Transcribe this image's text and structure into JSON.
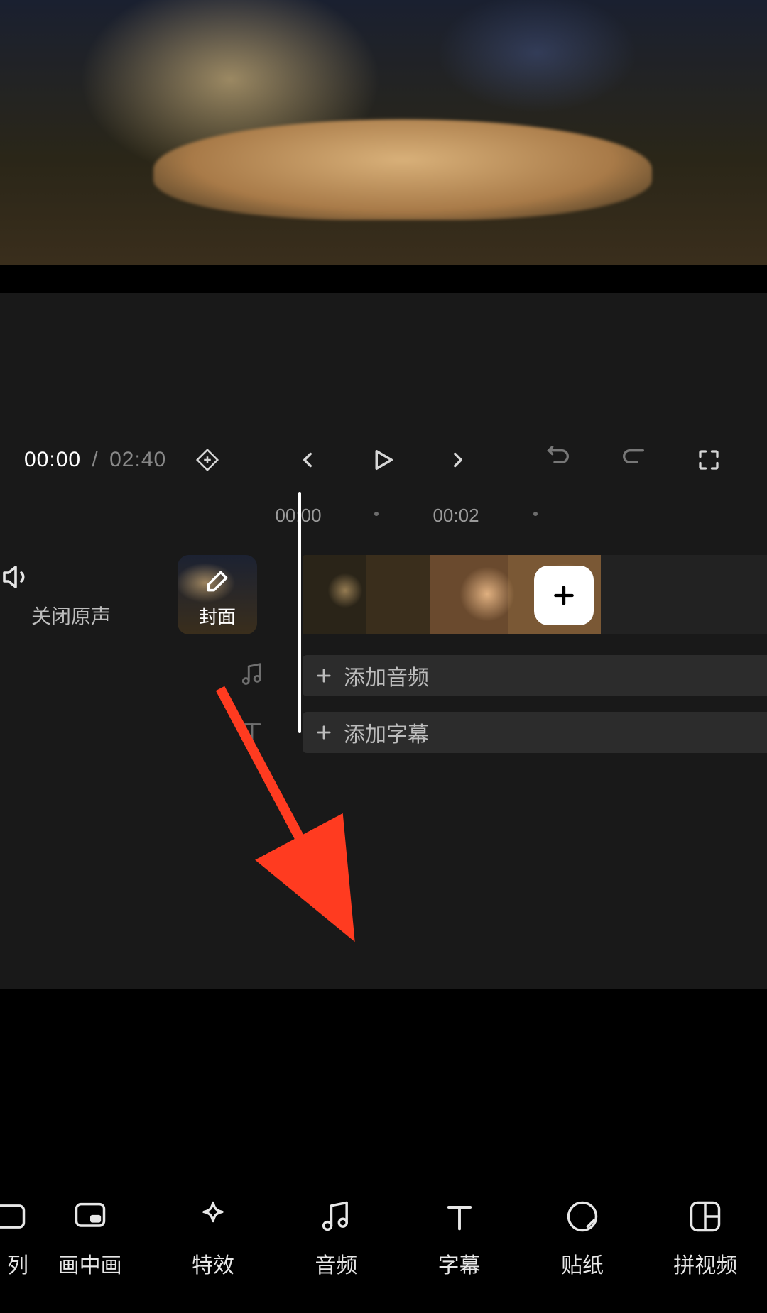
{
  "playback": {
    "current_time": "00:00",
    "separator": "/",
    "duration": "02:40"
  },
  "ruler": {
    "tick1": "00:00",
    "tick2": "00:02"
  },
  "timeline": {
    "mute_label": "关闭原声",
    "cover_label": "封面",
    "add_audio_label": "添加音频",
    "add_subtitle_label": "添加字幕"
  },
  "toolbar": {
    "item0_label": "列",
    "item1_label": "画中画",
    "item2_label": "特效",
    "item3_label": "音频",
    "item4_label": "字幕",
    "item5_label": "贴纸",
    "item6_label": "拼视频"
  }
}
